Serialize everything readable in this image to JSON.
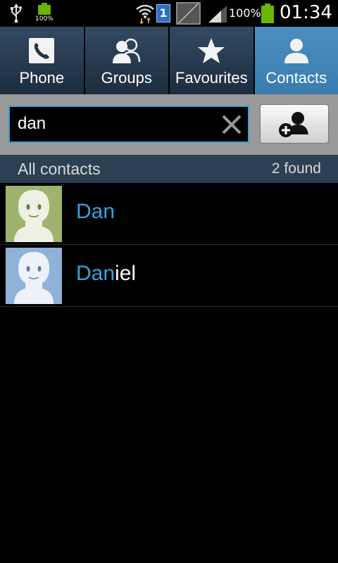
{
  "status_bar": {
    "battery_small_label": "100%",
    "sim_label": "1",
    "battery_percent": "100%",
    "time": "01:34",
    "icons": [
      "usb-icon",
      "battery-full-icon",
      "wifi-icon",
      "sim-icon",
      "gallery-icon",
      "signal-icon",
      "battery-icon"
    ]
  },
  "tabs": [
    {
      "label": "Phone",
      "icon": "phone-icon",
      "active": false
    },
    {
      "label": "Groups",
      "icon": "groups-icon",
      "active": false
    },
    {
      "label": "Favourites",
      "icon": "star-icon",
      "active": false
    },
    {
      "label": "Contacts",
      "icon": "contact-icon",
      "active": true
    }
  ],
  "search": {
    "value": "dan",
    "clear_icon": "close-icon",
    "add_button_icon": "add-contact-icon"
  },
  "list_header": {
    "title": "All contacts",
    "count": "2 found"
  },
  "contacts": [
    {
      "match": "Dan",
      "rest": "",
      "avatar_color": "#9fb36e"
    },
    {
      "match": "Dan",
      "rest": "iel",
      "avatar_color": "#8fb2d9"
    }
  ],
  "colors": {
    "accent": "#33a3dc",
    "tab_active": "#3f86b8",
    "tab_inactive": "#263a50",
    "header_bg": "#2d3f52",
    "search_area_bg": "#9a9a9a",
    "battery": "#6bb400"
  }
}
